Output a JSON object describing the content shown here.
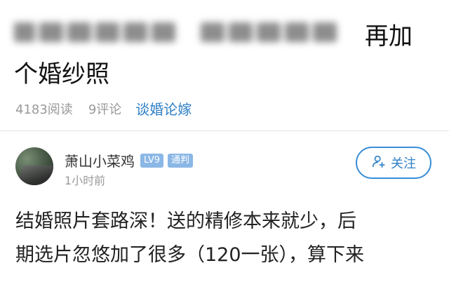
{
  "article": {
    "title_visible_part1": "再加",
    "title_visible_part2": "个婚纱照",
    "reads": "4183阅读",
    "comments": "9评论",
    "category": "谈婚论嫁"
  },
  "author": {
    "name": "萧山小菜鸡",
    "level_badge": "LV9",
    "role_badge": "通判",
    "time": "1小时前",
    "follow_label": "关注"
  },
  "body": {
    "line1": "结婚照片套路深！送的精修本来就少，后",
    "line2": "期选片忽悠加了很多（120一张），算下来"
  },
  "icons": {
    "follow": "add-person-icon"
  }
}
